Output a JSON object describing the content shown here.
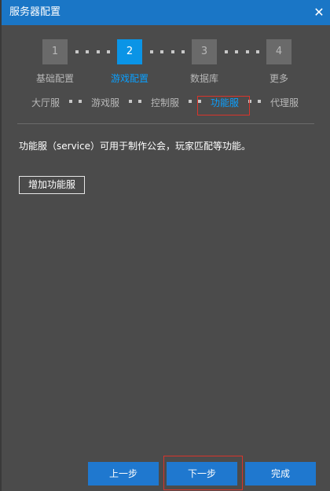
{
  "window": {
    "title": "服务器配置",
    "close_symbol": "✕"
  },
  "steps": [
    {
      "number": "1",
      "label": "基础配置",
      "active": false
    },
    {
      "number": "2",
      "label": "游戏配置",
      "active": true
    },
    {
      "number": "3",
      "label": "数据库",
      "active": false
    },
    {
      "number": "4",
      "label": "更多",
      "active": false
    }
  ],
  "subtabs": [
    {
      "label": "大厅服",
      "active": false
    },
    {
      "label": "游戏服",
      "active": false
    },
    {
      "label": "控制服",
      "active": false
    },
    {
      "label": "功能服",
      "active": true
    },
    {
      "label": "代理服",
      "active": false
    }
  ],
  "content": {
    "description": "功能服（service）可用于制作公会，玩家匹配等功能。",
    "add_button": "增加功能服"
  },
  "footer": {
    "prev": "上一步",
    "next": "下一步",
    "finish": "完成"
  },
  "colors": {
    "titlebar": "#1a76c6",
    "accent": "#0a94e6",
    "background": "#4b4b4b",
    "highlight": "#d9342b"
  }
}
